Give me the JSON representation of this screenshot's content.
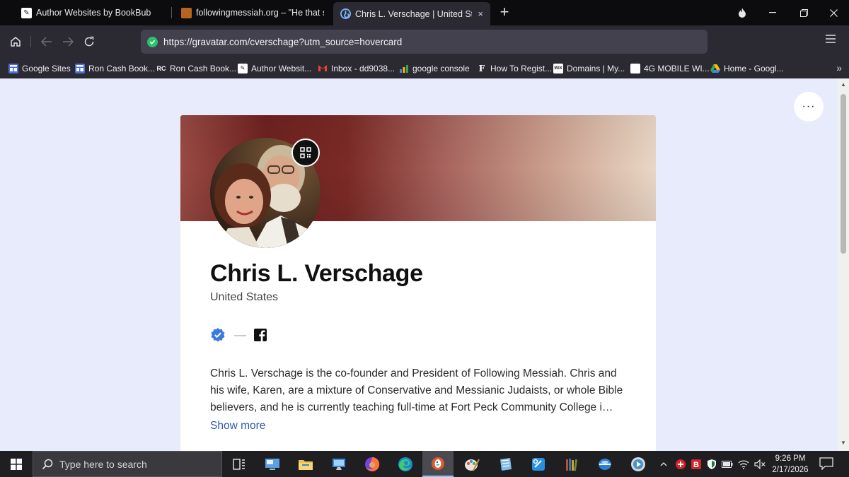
{
  "browser": {
    "tabs": [
      {
        "title": "Author Websites by BookBub",
        "active": false
      },
      {
        "title": "followingmessiah.org – \"He that sa",
        "active": false
      },
      {
        "title": "Chris L. Verschage | United Sta",
        "active": true,
        "close_icon": "×"
      }
    ],
    "new_tab_icon": "+",
    "url": "https://gravatar.com/cverschage?utm_source=hovercard",
    "bookmarks": [
      {
        "label": "Google Sites",
        "icon": "google-sites-icon"
      },
      {
        "label": "Ron Cash Book...",
        "icon": "sites-icon"
      },
      {
        "label": "Ron Cash Book...",
        "icon": "rc-icon"
      },
      {
        "label": "Author Websit...",
        "icon": "bookbub-icon"
      },
      {
        "label": "Inbox - dd9038...",
        "icon": "gmail-icon"
      },
      {
        "label": "google console",
        "icon": "search-console-icon"
      },
      {
        "label": "How To Regist...",
        "icon": "f-icon"
      },
      {
        "label": "Domains | My...",
        "icon": "wix-icon"
      },
      {
        "label": "4G MOBILE WI...",
        "icon": "blank-page-icon"
      },
      {
        "label": "Home - Googl...",
        "icon": "google-drive-icon"
      }
    ]
  },
  "profile": {
    "name": "Chris L. Verschage",
    "location": "United States",
    "bio": "Chris L. Verschage is the co-founder and President of Following Messiah. Chris and his wife, Karen, are a mixture of Conservative and Messianic Judaists, or whole Bible believers, and he is currently teaching full-time at Fort Peck Community College i…",
    "show_more": "Show more",
    "more_menu": "···"
  },
  "taskbar": {
    "search_placeholder": "Type here to search",
    "time": "9:26 PM",
    "date": "2/17/2026"
  },
  "colors": {
    "accent": "#2f5ba6",
    "verified": "#3d7ae0",
    "browser_chrome": "#2b2a33",
    "page_background": "#e8ebfb"
  }
}
